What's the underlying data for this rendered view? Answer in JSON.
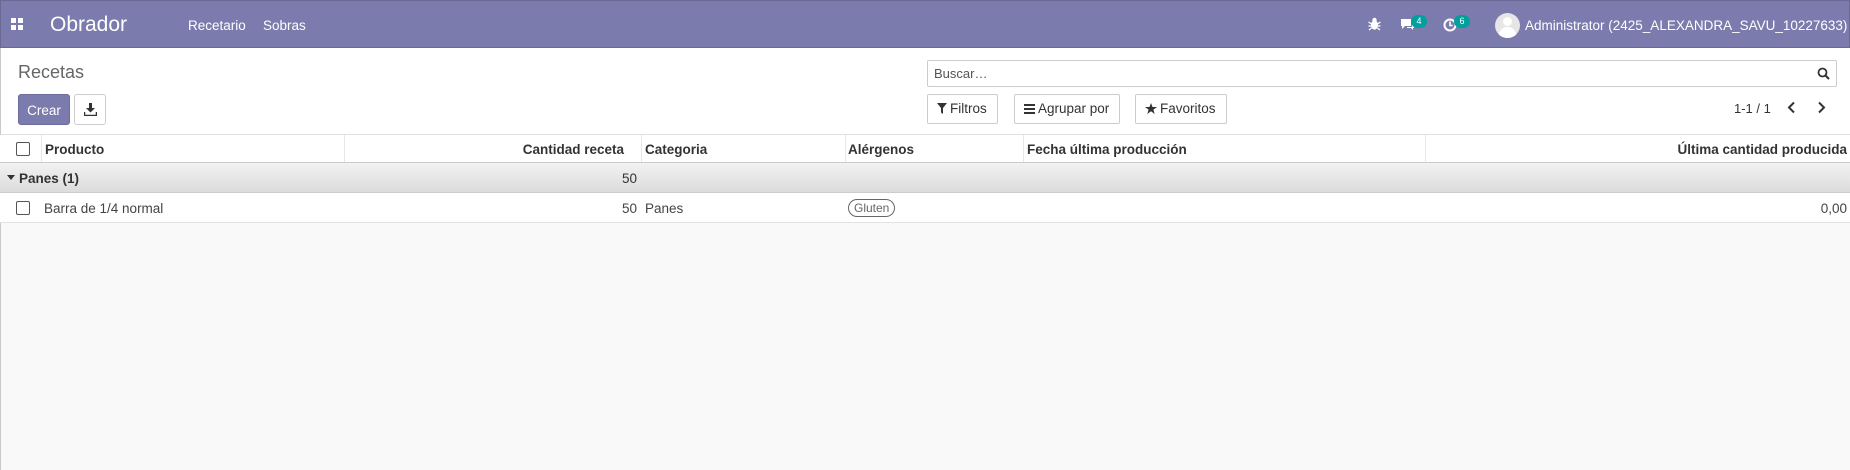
{
  "navbar": {
    "apps_icon": "apps-grid-icon",
    "brand": "Obrador",
    "menu": [
      "Recetario",
      "Sobras"
    ],
    "debug_icon": "bug-icon",
    "messages_icon": "chat-icon",
    "messages_count": "4",
    "activities_icon": "clock-icon",
    "activities_count": "6",
    "user": "Administrator (2425_ALEXANDRA_SAVU_10227633)",
    "color": "#7c7bad"
  },
  "control_panel": {
    "breadcrumb": "Recetas",
    "create_label": "Crear",
    "download_icon": "download-icon",
    "search_placeholder": "Buscar…",
    "filters_label": "Filtros",
    "group_by_label": "Agrupar por",
    "favorites_label": "Favoritos",
    "pager": "1-1 / 1"
  },
  "table": {
    "columns": [
      "Producto",
      "Cantidad receta",
      "Categoria",
      "Alérgenos",
      "Fecha última producción",
      "Última cantidad producida"
    ],
    "group": {
      "label": "Panes (1)",
      "total": "50"
    },
    "rows": [
      {
        "producto": "Barra de 1/4 normal",
        "cantidad": "50",
        "categoria": "Panes",
        "alergenos": "Gluten",
        "fecha": "",
        "ultima_cantidad": "0,00"
      }
    ]
  }
}
